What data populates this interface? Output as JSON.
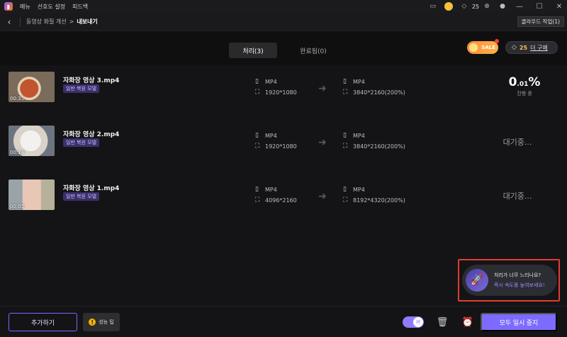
{
  "titlebar": {
    "menus": [
      "메뉴",
      "선호도 설정",
      "피드백"
    ],
    "credits": "25"
  },
  "breadcrumb": {
    "parent": "동영상 화질 개선",
    "separator": ">",
    "current": "내보내기",
    "cloud_button": "클라우드 작업(1)"
  },
  "tabs": [
    {
      "label": "처리(3)",
      "active": true
    },
    {
      "label": "완료됨(0)",
      "active": false
    }
  ],
  "promo": {
    "sale_label": "SALE",
    "credits": "25",
    "buy_label": "더 구매"
  },
  "rows": [
    {
      "title": "자화장 영상 3.mp4",
      "duration": "00:35",
      "model": "일반 복원 모델",
      "src_format": "MP4",
      "src_res": "1920*1080",
      "dst_format": "MP4",
      "dst_res": "3840*2160(200%)",
      "status": "progress",
      "progress_main": "0",
      "progress_decimal": ".01",
      "progress_unit": "%",
      "progress_label": "진행 중"
    },
    {
      "title": "자화장 영상 2.mp4",
      "duration": "00:14",
      "model": "일반 복원 모델",
      "src_format": "MP4",
      "src_res": "1920*1080",
      "dst_format": "MP4",
      "dst_res": "3840*2160(200%)",
      "status": "waiting",
      "waiting_label": "대기중..."
    },
    {
      "title": "자화장 영상 1.mp4",
      "duration": "00:05",
      "model": "일반 복원 모델",
      "src_format": "MP4",
      "src_res": "4096*2160",
      "dst_format": "MP4",
      "dst_res": "8192*4320(200%)",
      "status": "waiting",
      "waiting_label": "대기중..."
    }
  ],
  "toast": {
    "title": "처리가 너무 느리나요?",
    "link": "즉시 속도를 높여보세요!"
  },
  "bottombar": {
    "add_label": "추가하기",
    "tip_label": "성능 팁",
    "stop_all_label": "모두 일시 중지"
  },
  "colors": {
    "accent": "#7d6bff",
    "highlight_border": "#e33b32",
    "tag_bg": "#3b2f6b"
  }
}
